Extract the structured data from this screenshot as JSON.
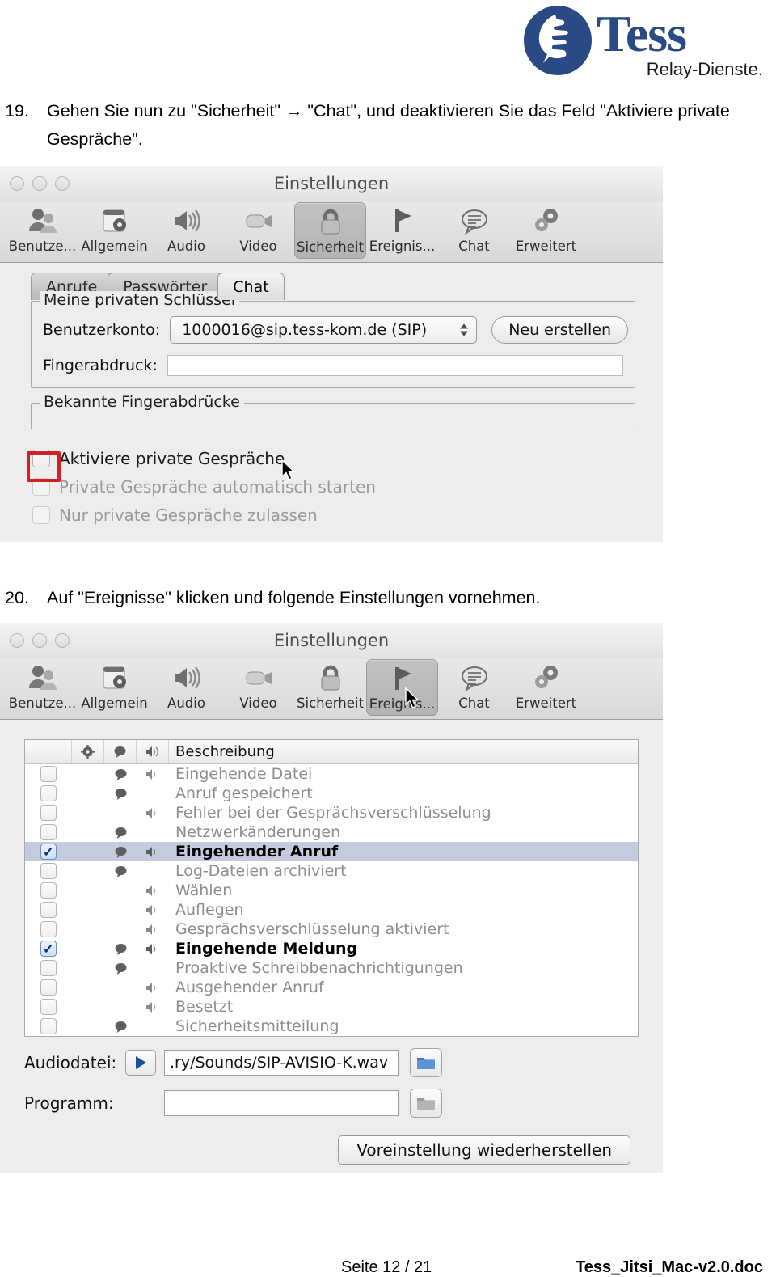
{
  "logo": {
    "wordmark": "Tess",
    "tagline": "Relay-Dienste.",
    "mark_icon": "thumbs-up-hand-icon",
    "brand_blue": "#2a4a86"
  },
  "steps": [
    {
      "number": "19.",
      "text": "Gehen Sie nun zu \"Sicherheit\" → \"Chat\", und deaktivieren Sie das Feld \"Aktiviere private Gespräche\"."
    },
    {
      "number": "20.",
      "text": "Auf \"Ereignisse\" klicken und folgende Einstellungen vornehmen."
    }
  ],
  "screenshot1": {
    "window_title": "Einstellungen",
    "traffic_lights": [
      "close-light",
      "minimize-light",
      "zoom-light"
    ],
    "toolbar": [
      {
        "label": "Benutze...",
        "icon": "users-icon",
        "selected": false
      },
      {
        "label": "Allgemein",
        "icon": "general-gear-icon",
        "selected": false
      },
      {
        "label": "Audio",
        "icon": "speaker-icon",
        "selected": false
      },
      {
        "label": "Video",
        "icon": "camera-icon",
        "selected": false
      },
      {
        "label": "Sicherheit",
        "icon": "lock-icon",
        "selected": true
      },
      {
        "label": "Ereignis...",
        "icon": "flag-icon",
        "selected": false
      },
      {
        "label": "Chat",
        "icon": "speech-bubble-icon",
        "selected": false
      },
      {
        "label": "Erweitert",
        "icon": "gears-icon",
        "selected": false
      }
    ],
    "subtabs": [
      {
        "label": "Anrufe",
        "active": false
      },
      {
        "label": "Passwörter",
        "active": false
      },
      {
        "label": "Chat",
        "active": true
      }
    ],
    "group_private_keys": {
      "title": "Meine privaten Schlüssel",
      "account_label": "Benutzerkonto:",
      "account_value": "1000016@sip.tess-kom.de (SIP)",
      "create_button": "Neu erstellen",
      "fingerprint_label": "Fingerabdruck:",
      "fingerprint_value": ""
    },
    "group_known_fingerprints": {
      "title": "Bekannte Fingerabdrücke"
    },
    "checkboxes": [
      {
        "label": "Aktiviere private Gespräche",
        "checked": false,
        "enabled": true,
        "highlighted": true
      },
      {
        "label": "Private Gespräche automatisch starten",
        "checked": false,
        "enabled": false,
        "highlighted": false
      },
      {
        "label": "Nur private Gespräche zulassen",
        "checked": false,
        "enabled": false,
        "highlighted": false
      }
    ],
    "highlight_color": "#d02128",
    "cursor": "arrow-cursor"
  },
  "screenshot2": {
    "window_title": "Einstellungen",
    "traffic_lights": [
      "close-light",
      "minimize-light",
      "zoom-light"
    ],
    "toolbar": [
      {
        "label": "Benutze...",
        "icon": "users-icon",
        "selected": false
      },
      {
        "label": "Allgemein",
        "icon": "general-gear-icon",
        "selected": false
      },
      {
        "label": "Audio",
        "icon": "speaker-icon",
        "selected": false
      },
      {
        "label": "Video",
        "icon": "camera-icon",
        "selected": false
      },
      {
        "label": "Sicherheit",
        "icon": "lock-icon",
        "selected": false
      },
      {
        "label": "Ereignis...",
        "icon": "flag-icon",
        "selected": true
      },
      {
        "label": "Chat",
        "icon": "speech-bubble-icon",
        "selected": false
      },
      {
        "label": "Erweitert",
        "icon": "gears-icon",
        "selected": false
      }
    ],
    "events_table": {
      "columns": [
        {
          "name": "enabled-column",
          "icon": ""
        },
        {
          "name": "popup-column",
          "icon": "gear-icon"
        },
        {
          "name": "message-column",
          "icon": "speech-bubble-icon"
        },
        {
          "name": "sound-column",
          "icon": "speaker-icon"
        },
        {
          "name": "description-column",
          "icon": "",
          "label": "Beschreibung"
        }
      ],
      "rows": [
        {
          "label": "Eingehende Datei",
          "checked": false,
          "bubble": true,
          "sound": true
        },
        {
          "label": "Anruf gespeichert",
          "checked": false,
          "bubble": true,
          "sound": false
        },
        {
          "label": "Fehler bei der Gesprächsverschlüsselung",
          "checked": false,
          "bubble": false,
          "sound": true
        },
        {
          "label": "Netzwerkänderungen",
          "checked": false,
          "bubble": true,
          "sound": false
        },
        {
          "label": "Eingehender Anruf",
          "checked": true,
          "bubble": true,
          "sound": true,
          "selected": true
        },
        {
          "label": "Log-Dateien archiviert",
          "checked": false,
          "bubble": true,
          "sound": false
        },
        {
          "label": "Wählen",
          "checked": false,
          "bubble": false,
          "sound": true
        },
        {
          "label": "Auflegen",
          "checked": false,
          "bubble": false,
          "sound": true
        },
        {
          "label": "Gesprächsverschlüsselung aktiviert",
          "checked": false,
          "bubble": false,
          "sound": true
        },
        {
          "label": "Eingehende Meldung",
          "checked": true,
          "bubble": true,
          "sound": true
        },
        {
          "label": "Proaktive Schreibbenachrichtigungen",
          "checked": false,
          "bubble": true,
          "sound": false
        },
        {
          "label": "Ausgehender Anruf",
          "checked": false,
          "bubble": false,
          "sound": true
        },
        {
          "label": "Besetzt",
          "checked": false,
          "bubble": false,
          "sound": true
        },
        {
          "label": "Sicherheitsmitteilung",
          "checked": false,
          "bubble": true,
          "sound": false
        }
      ]
    },
    "audio_label": "Audiodatei:",
    "audio_value": ".ry/Sounds/SIP-AVISIO-K.wav",
    "audio_play_icon": "play-icon",
    "audio_browse_icon": "folder-icon",
    "program_label": "Programm:",
    "program_value": "",
    "program_browse_icon": "folder-icon",
    "restore_button": "Voreinstellung wiederherstellen",
    "cursor": "arrow-cursor"
  },
  "footer": {
    "page": "Seite 12 / 21",
    "document": "Tess_Jitsi_Mac-v2.0.doc"
  }
}
